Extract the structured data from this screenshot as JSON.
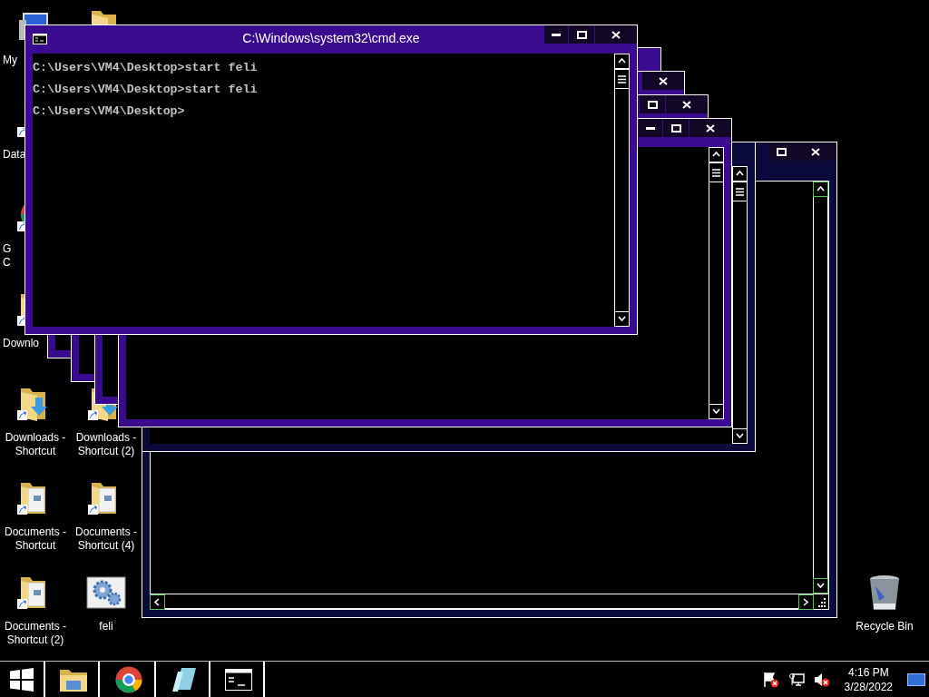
{
  "desktop_icons": [
    {
      "kind": "computer",
      "shortcut": false,
      "label": [
        "My"
      ]
    },
    {
      "kind": "data",
      "shortcut": true,
      "label": [
        "Data"
      ]
    },
    {
      "kind": "chrome",
      "shortcut": true,
      "label": [
        "G",
        "C"
      ]
    },
    {
      "kind": "folder",
      "shortcut": true,
      "label": [
        "Downlo"
      ]
    },
    {
      "kind": "download",
      "shortcut": true,
      "label": [
        "Downloads -",
        "Shortcut"
      ]
    },
    {
      "kind": "documents",
      "shortcut": true,
      "label": [
        "Documents -",
        "Shortcut"
      ]
    },
    {
      "kind": "documents",
      "shortcut": true,
      "label": [
        "Documents -",
        "Shortcut (2)"
      ]
    },
    {
      "kind": "folder"
    },
    {
      "kind": "download",
      "shortcut": true,
      "label": [
        "Downloads -",
        "Shortcut (2)"
      ]
    },
    {
      "kind": "documents",
      "shortcut": true,
      "label": [
        "Documents -",
        "Shortcut (4)"
      ]
    },
    {
      "kind": "gears",
      "shortcut": false,
      "label": [
        "feli"
      ]
    },
    {
      "kind": "recycle",
      "shortcut": false,
      "label": [
        "Recycle Bin"
      ]
    }
  ],
  "windows": [
    {
      "kind": "console",
      "title": "C:\\Windows\\system32\\cmd.exe",
      "buttons": [
        {
          "kind": "minimize"
        },
        {
          "kind": "maximize"
        },
        {
          "kind": "close"
        }
      ],
      "lines": [
        "C:\\Users\\VM4\\Desktop>start feli",
        "C:\\Users\\VM4\\Desktop>start feli",
        "C:\\Users\\VM4\\Desktop>"
      ]
    },
    {
      "kind": "console"
    },
    {
      "kind": "console",
      "buttons": [
        {
          "kind": "close"
        }
      ]
    },
    {
      "kind": "console",
      "buttons": [
        {
          "kind": "maximize"
        },
        {
          "kind": "close"
        }
      ]
    },
    {
      "kind": "console",
      "buttons": [
        {
          "kind": "minimize"
        },
        {
          "kind": "maximize"
        },
        {
          "kind": "close"
        }
      ]
    },
    {
      "kind": "panel"
    },
    {
      "kind": "viewer",
      "buttons": [
        {
          "kind": "maximize"
        },
        {
          "kind": "close"
        }
      ]
    }
  ],
  "taskbar": {
    "apps": [
      {
        "kind": "explorer"
      },
      {
        "kind": "chrome"
      },
      {
        "kind": "notepad"
      },
      {
        "kind": "console"
      }
    ],
    "tray": {
      "time": "4:16 PM",
      "date": "3/28/2022"
    }
  }
}
